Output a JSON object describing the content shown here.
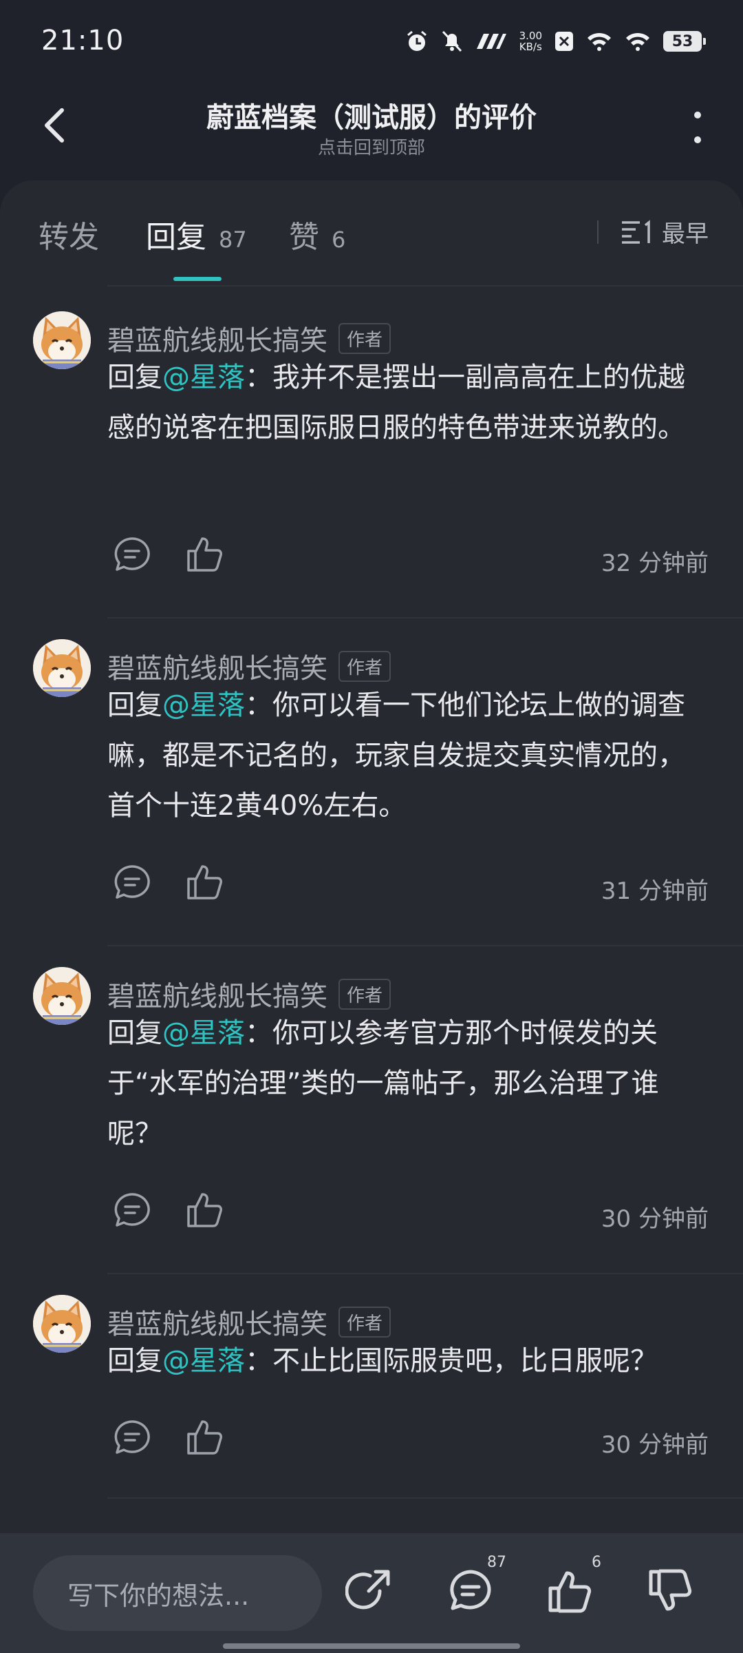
{
  "status_bar": {
    "time": "21:10",
    "net_speed_value": "3.00",
    "net_speed_unit": "KB/s",
    "battery": "53",
    "icons": [
      "alarm-icon",
      "mute-icon",
      "signal-brand-icon",
      "close-box-icon",
      "wifi-icon",
      "wifi-icon",
      "battery-icon"
    ]
  },
  "header": {
    "title": "蔚蓝档案（测试服）的评价",
    "subtitle": "点击回到顶部"
  },
  "tabs": [
    {
      "label": "转发",
      "count": ""
    },
    {
      "label": "回复",
      "count": "87"
    },
    {
      "label": "赞",
      "count": "6"
    }
  ],
  "active_tab": 1,
  "sort": {
    "label": "最早",
    "icon": "sort-list-icon"
  },
  "comments": [
    {
      "author": "碧蓝航线舰长搞笑",
      "badge": "作者",
      "prefix": "回复",
      "mention": "@星落",
      "sep": "：",
      "text": "我并不是摆出一副高高在上的优越感的说客在把国际服日服的特色带进来说教的。",
      "time": "32 分钟前"
    },
    {
      "author": "碧蓝航线舰长搞笑",
      "badge": "作者",
      "prefix": "回复",
      "mention": "@星落",
      "sep": "：",
      "text": "你可以看一下他们论坛上做的调查嘛，都是不记名的，玩家自发提交真实情况的，首个十连2黄40%左右。",
      "time": "31 分钟前"
    },
    {
      "author": "碧蓝航线舰长搞笑",
      "badge": "作者",
      "prefix": "回复",
      "mention": "@星落",
      "sep": "：",
      "text": "你可以参考官方那个时候发的关于“水军的治理”类的一篇帖子，那么治理了谁呢？",
      "time": "30 分钟前"
    },
    {
      "author": "碧蓝航线舰长搞笑",
      "badge": "作者",
      "prefix": "回复",
      "mention": "@星落",
      "sep": "：",
      "text": "不止比国际服贵吧，比日服呢？",
      "time": "30 分钟前"
    }
  ],
  "bottom_bar": {
    "placeholder": "写下你的想法...",
    "comment_count": "87",
    "like_count": "6"
  },
  "colors": {
    "background": "#1f222a",
    "panel": "#262930",
    "accent": "#2fc4c4"
  }
}
